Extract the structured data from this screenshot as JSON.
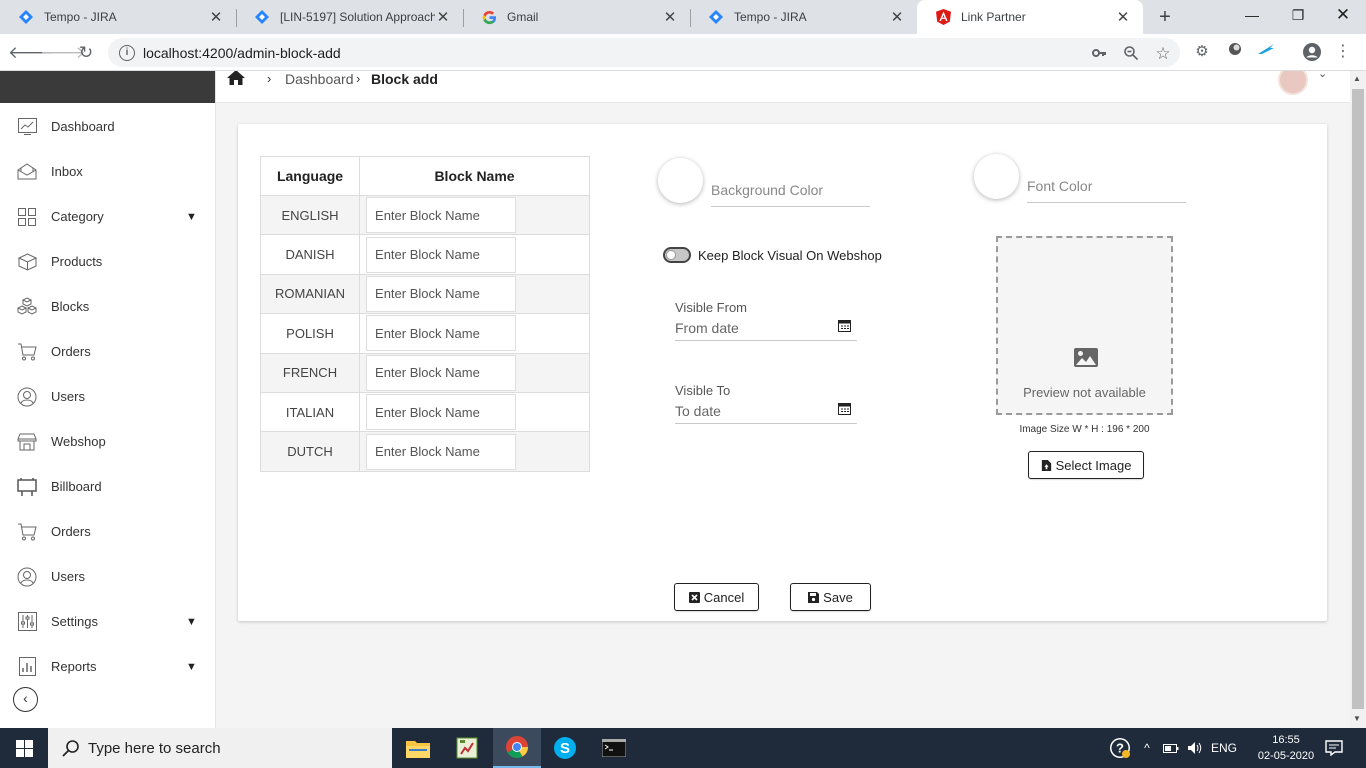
{
  "browser": {
    "tabs": [
      {
        "title": "Tempo - JIRA",
        "icon": "jira-icon"
      },
      {
        "title": "[LIN-5197] Solution Approach",
        "icon": "jira-icon"
      },
      {
        "title": "Gmail",
        "icon": "google-icon"
      },
      {
        "title": "Tempo - JIRA",
        "icon": "jira-icon"
      },
      {
        "title": "Link Partner",
        "icon": "angular-icon"
      }
    ],
    "url": "localhost:4200/admin-block-add",
    "close_glyph": "✕",
    "newtab_glyph": "+"
  },
  "breadcrumb": {
    "items": [
      "Dashboard",
      "Block add"
    ]
  },
  "sidebar": {
    "items": [
      {
        "label": "Dashboard",
        "icon": "chart-icon"
      },
      {
        "label": "Inbox",
        "icon": "inbox-icon"
      },
      {
        "label": "Category",
        "icon": "grid-icon",
        "expandable": true
      },
      {
        "label": "Products",
        "icon": "box-icon"
      },
      {
        "label": "Blocks",
        "icon": "blocks-icon"
      },
      {
        "label": "Orders",
        "icon": "cart-icon"
      },
      {
        "label": "Users",
        "icon": "user-icon"
      },
      {
        "label": "Webshop",
        "icon": "shop-icon"
      },
      {
        "label": "Billboard",
        "icon": "billboard-icon"
      },
      {
        "label": "Orders",
        "icon": "cart-icon"
      },
      {
        "label": "Users",
        "icon": "user-icon"
      },
      {
        "label": "Settings",
        "icon": "sliders-icon",
        "expandable": true
      },
      {
        "label": "Reports",
        "icon": "report-icon",
        "expandable": true
      }
    ]
  },
  "form": {
    "table": {
      "headers": [
        "Language",
        "Block Name"
      ],
      "placeholder": "Enter Block Name",
      "rows": [
        "ENGLISH",
        "DANISH",
        "ROMANIAN",
        "POLISH",
        "FRENCH",
        "ITALIAN",
        "DUTCH"
      ]
    },
    "background_color_placeholder": "Background Color",
    "font_color_placeholder": "Font Color",
    "toggle_label": "Keep Block Visual On Webshop",
    "toggle_on": false,
    "visible_from_label": "Visible From",
    "visible_from_placeholder": "From date",
    "visible_to_label": "Visible To",
    "visible_to_placeholder": "To date",
    "preview_text": "Preview not available",
    "image_size_text": "Image Size W * H : 196 * 200",
    "select_image_label": "Select Image",
    "cancel_label": "Cancel",
    "save_label": "Save"
  },
  "taskbar": {
    "search_placeholder": "Type here to search",
    "language": "ENG",
    "time": "16:55",
    "date": "02-05-2020"
  },
  "colors": {
    "sidebar_logo_bg": "#3a3a3a",
    "taskbar_bg": "#1f2a3a",
    "table_stripe": "#f4f4f4"
  }
}
